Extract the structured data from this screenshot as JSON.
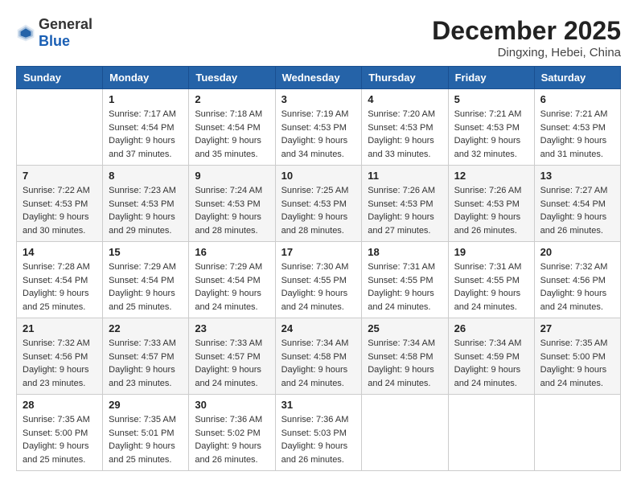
{
  "header": {
    "logo_general": "General",
    "logo_blue": "Blue",
    "month": "December 2025",
    "location": "Dingxing, Hebei, China"
  },
  "weekdays": [
    "Sunday",
    "Monday",
    "Tuesday",
    "Wednesday",
    "Thursday",
    "Friday",
    "Saturday"
  ],
  "weeks": [
    [
      {
        "day": "",
        "sunrise": "",
        "sunset": "",
        "daylight": ""
      },
      {
        "day": "1",
        "sunrise": "Sunrise: 7:17 AM",
        "sunset": "Sunset: 4:54 PM",
        "daylight": "Daylight: 9 hours and 37 minutes."
      },
      {
        "day": "2",
        "sunrise": "Sunrise: 7:18 AM",
        "sunset": "Sunset: 4:54 PM",
        "daylight": "Daylight: 9 hours and 35 minutes."
      },
      {
        "day": "3",
        "sunrise": "Sunrise: 7:19 AM",
        "sunset": "Sunset: 4:53 PM",
        "daylight": "Daylight: 9 hours and 34 minutes."
      },
      {
        "day": "4",
        "sunrise": "Sunrise: 7:20 AM",
        "sunset": "Sunset: 4:53 PM",
        "daylight": "Daylight: 9 hours and 33 minutes."
      },
      {
        "day": "5",
        "sunrise": "Sunrise: 7:21 AM",
        "sunset": "Sunset: 4:53 PM",
        "daylight": "Daylight: 9 hours and 32 minutes."
      },
      {
        "day": "6",
        "sunrise": "Sunrise: 7:21 AM",
        "sunset": "Sunset: 4:53 PM",
        "daylight": "Daylight: 9 hours and 31 minutes."
      }
    ],
    [
      {
        "day": "7",
        "sunrise": "Sunrise: 7:22 AM",
        "sunset": "Sunset: 4:53 PM",
        "daylight": "Daylight: 9 hours and 30 minutes."
      },
      {
        "day": "8",
        "sunrise": "Sunrise: 7:23 AM",
        "sunset": "Sunset: 4:53 PM",
        "daylight": "Daylight: 9 hours and 29 minutes."
      },
      {
        "day": "9",
        "sunrise": "Sunrise: 7:24 AM",
        "sunset": "Sunset: 4:53 PM",
        "daylight": "Daylight: 9 hours and 28 minutes."
      },
      {
        "day": "10",
        "sunrise": "Sunrise: 7:25 AM",
        "sunset": "Sunset: 4:53 PM",
        "daylight": "Daylight: 9 hours and 28 minutes."
      },
      {
        "day": "11",
        "sunrise": "Sunrise: 7:26 AM",
        "sunset": "Sunset: 4:53 PM",
        "daylight": "Daylight: 9 hours and 27 minutes."
      },
      {
        "day": "12",
        "sunrise": "Sunrise: 7:26 AM",
        "sunset": "Sunset: 4:53 PM",
        "daylight": "Daylight: 9 hours and 26 minutes."
      },
      {
        "day": "13",
        "sunrise": "Sunrise: 7:27 AM",
        "sunset": "Sunset: 4:54 PM",
        "daylight": "Daylight: 9 hours and 26 minutes."
      }
    ],
    [
      {
        "day": "14",
        "sunrise": "Sunrise: 7:28 AM",
        "sunset": "Sunset: 4:54 PM",
        "daylight": "Daylight: 9 hours and 25 minutes."
      },
      {
        "day": "15",
        "sunrise": "Sunrise: 7:29 AM",
        "sunset": "Sunset: 4:54 PM",
        "daylight": "Daylight: 9 hours and 25 minutes."
      },
      {
        "day": "16",
        "sunrise": "Sunrise: 7:29 AM",
        "sunset": "Sunset: 4:54 PM",
        "daylight": "Daylight: 9 hours and 24 minutes."
      },
      {
        "day": "17",
        "sunrise": "Sunrise: 7:30 AM",
        "sunset": "Sunset: 4:55 PM",
        "daylight": "Daylight: 9 hours and 24 minutes."
      },
      {
        "day": "18",
        "sunrise": "Sunrise: 7:31 AM",
        "sunset": "Sunset: 4:55 PM",
        "daylight": "Daylight: 9 hours and 24 minutes."
      },
      {
        "day": "19",
        "sunrise": "Sunrise: 7:31 AM",
        "sunset": "Sunset: 4:55 PM",
        "daylight": "Daylight: 9 hours and 24 minutes."
      },
      {
        "day": "20",
        "sunrise": "Sunrise: 7:32 AM",
        "sunset": "Sunset: 4:56 PM",
        "daylight": "Daylight: 9 hours and 24 minutes."
      }
    ],
    [
      {
        "day": "21",
        "sunrise": "Sunrise: 7:32 AM",
        "sunset": "Sunset: 4:56 PM",
        "daylight": "Daylight: 9 hours and 23 minutes."
      },
      {
        "day": "22",
        "sunrise": "Sunrise: 7:33 AM",
        "sunset": "Sunset: 4:57 PM",
        "daylight": "Daylight: 9 hours and 23 minutes."
      },
      {
        "day": "23",
        "sunrise": "Sunrise: 7:33 AM",
        "sunset": "Sunset: 4:57 PM",
        "daylight": "Daylight: 9 hours and 24 minutes."
      },
      {
        "day": "24",
        "sunrise": "Sunrise: 7:34 AM",
        "sunset": "Sunset: 4:58 PM",
        "daylight": "Daylight: 9 hours and 24 minutes."
      },
      {
        "day": "25",
        "sunrise": "Sunrise: 7:34 AM",
        "sunset": "Sunset: 4:58 PM",
        "daylight": "Daylight: 9 hours and 24 minutes."
      },
      {
        "day": "26",
        "sunrise": "Sunrise: 7:34 AM",
        "sunset": "Sunset: 4:59 PM",
        "daylight": "Daylight: 9 hours and 24 minutes."
      },
      {
        "day": "27",
        "sunrise": "Sunrise: 7:35 AM",
        "sunset": "Sunset: 5:00 PM",
        "daylight": "Daylight: 9 hours and 24 minutes."
      }
    ],
    [
      {
        "day": "28",
        "sunrise": "Sunrise: 7:35 AM",
        "sunset": "Sunset: 5:00 PM",
        "daylight": "Daylight: 9 hours and 25 minutes."
      },
      {
        "day": "29",
        "sunrise": "Sunrise: 7:35 AM",
        "sunset": "Sunset: 5:01 PM",
        "daylight": "Daylight: 9 hours and 25 minutes."
      },
      {
        "day": "30",
        "sunrise": "Sunrise: 7:36 AM",
        "sunset": "Sunset: 5:02 PM",
        "daylight": "Daylight: 9 hours and 26 minutes."
      },
      {
        "day": "31",
        "sunrise": "Sunrise: 7:36 AM",
        "sunset": "Sunset: 5:03 PM",
        "daylight": "Daylight: 9 hours and 26 minutes."
      },
      {
        "day": "",
        "sunrise": "",
        "sunset": "",
        "daylight": ""
      },
      {
        "day": "",
        "sunrise": "",
        "sunset": "",
        "daylight": ""
      },
      {
        "day": "",
        "sunrise": "",
        "sunset": "",
        "daylight": ""
      }
    ]
  ]
}
